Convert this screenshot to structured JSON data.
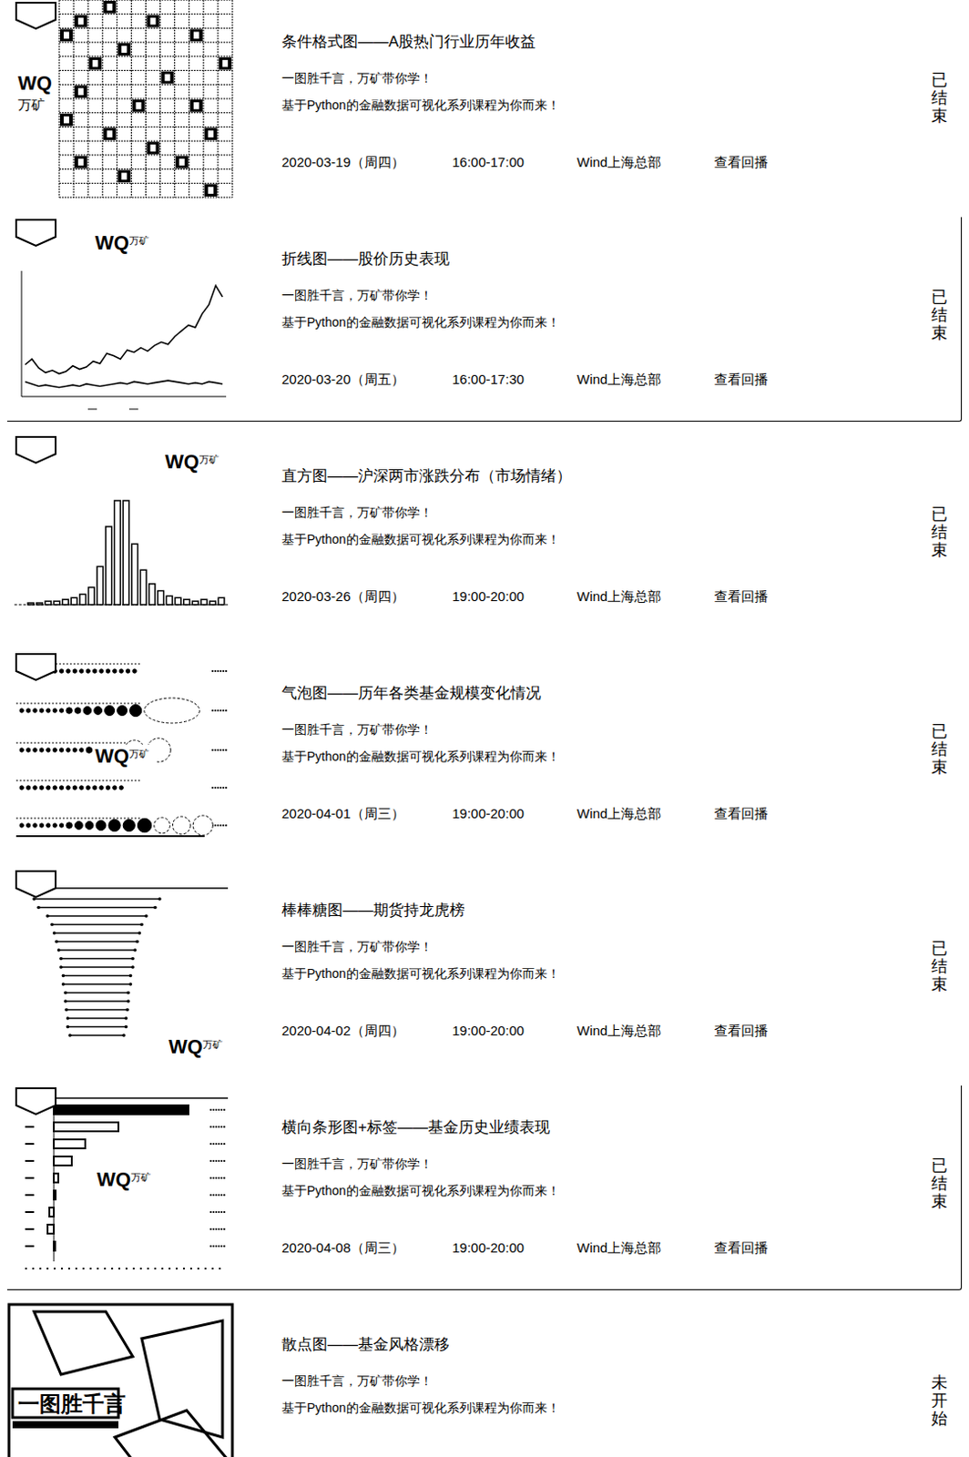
{
  "logo": {
    "mark": "WQ",
    "name": "万矿"
  },
  "courses": [
    {
      "title": "条件格式图——A股热门行业历年收益",
      "desc": [
        "一图胜千言，万矿带你学！",
        "基于Python的金融数据可视化系列课程为你而来！"
      ],
      "meta": {
        "date": "2020-03-19（周四）",
        "time": "16:00-17:00",
        "place": "Wind上海总部",
        "action": "查看回播"
      },
      "status": "已结束",
      "hovered": false,
      "thumb": {
        "kind": "grid",
        "rows": 14,
        "cols": 12,
        "marked": [
          [
            0,
            3
          ],
          [
            1,
            1
          ],
          [
            1,
            6
          ],
          [
            2,
            0
          ],
          [
            2,
            9
          ],
          [
            3,
            4
          ],
          [
            4,
            2
          ],
          [
            4,
            11
          ],
          [
            5,
            7
          ],
          [
            6,
            1
          ],
          [
            7,
            5
          ],
          [
            7,
            9
          ],
          [
            8,
            0
          ],
          [
            9,
            3
          ],
          [
            9,
            10
          ],
          [
            10,
            6
          ],
          [
            11,
            1
          ],
          [
            11,
            8
          ],
          [
            12,
            4
          ],
          [
            13,
            10
          ]
        ]
      }
    },
    {
      "title": "折线图——股价历史表现",
      "desc": [
        "一图胜千言，万矿带你学！",
        "基于Python的金融数据可视化系列课程为你而来！"
      ],
      "meta": {
        "date": "2020-03-20（周五）",
        "time": "16:00-17:30",
        "place": "Wind上海总部",
        "action": "查看回播"
      },
      "status": "已结束",
      "hovered": true,
      "thumb": {
        "kind": "line",
        "series": [
          [
            25,
            30,
            22,
            18,
            20,
            17,
            19,
            24,
            21,
            23,
            28,
            26,
            35,
            33,
            30,
            38,
            36,
            40,
            37,
            42,
            45,
            43,
            50,
            55,
            60,
            58,
            70,
            78,
            95,
            85
          ],
          [
            10,
            8,
            6,
            7,
            6,
            5,
            6,
            7,
            6,
            8,
            7,
            6,
            7,
            8,
            9,
            8,
            10,
            9,
            8,
            9,
            10,
            11,
            10,
            9,
            8,
            9,
            8,
            10,
            9,
            8
          ]
        ]
      }
    },
    {
      "title": "直方图——沪深两市涨跌分布（市场情绪）",
      "desc": [
        "一图胜千言，万矿带你学！",
        "基于Python的金融数据可视化系列课程为你而来！"
      ],
      "meta": {
        "date": "2020-03-26（周四）",
        "time": "19:00-20:00",
        "place": "Wind上海总部",
        "action": "查看回播"
      },
      "status": "已结束",
      "hovered": false,
      "thumb": {
        "kind": "histogram",
        "values": [
          1,
          1,
          2,
          2,
          3,
          4,
          6,
          10,
          22,
          45,
          60,
          60,
          35,
          20,
          12,
          8,
          5,
          4,
          3,
          2,
          3,
          2,
          4
        ]
      }
    },
    {
      "title": "气泡图——历年各类基金规模变化情况",
      "desc": [
        "一图胜千言，万矿带你学！",
        "基于Python的金融数据可视化系列课程为你而来！"
      ],
      "meta": {
        "date": "2020-04-01（周三）",
        "time": "19:00-20:00",
        "place": "Wind上海总部",
        "action": "查看回播"
      },
      "status": "已结束",
      "hovered": false,
      "thumb": {
        "kind": "bubble",
        "rows": [
          [
            1,
            1,
            1,
            1,
            1,
            1,
            1,
            1,
            1,
            1,
            1,
            1,
            1,
            1,
            1,
            1,
            1,
            1
          ],
          [
            1,
            1,
            1,
            1,
            1,
            1,
            1,
            1.5,
            1.5,
            2,
            2,
            2.5,
            2.5,
            3,
            14
          ],
          [
            1,
            1,
            1,
            1,
            1,
            1,
            1,
            1,
            1,
            1,
            1.5,
            1.5,
            2,
            2,
            5,
            6
          ],
          [
            1,
            1,
            1,
            1,
            1,
            1,
            1,
            1,
            1,
            1,
            1,
            1,
            1,
            1,
            1,
            1
          ],
          [
            1,
            1,
            1,
            1,
            1,
            1,
            1,
            1.5,
            2,
            2,
            2.5,
            3,
            3,
            3.5,
            4,
            4.5,
            5
          ]
        ]
      }
    },
    {
      "title": "棒棒糖图——期货持龙虎榜",
      "desc": [
        "一图胜千言，万矿带你学！",
        "基于Python的金融数据可视化系列课程为你而来！"
      ],
      "meta": {
        "date": "2020-04-02（周四）",
        "time": "19:00-20:00",
        "place": "Wind上海总部",
        "action": "查看回播"
      },
      "status": "已结束",
      "hovered": false,
      "thumb": {
        "kind": "lollipop",
        "values": [
          160,
          150,
          130,
          120,
          115,
          110,
          105,
          100,
          100,
          95,
          95,
          90,
          90,
          88,
          85,
          85,
          80
        ]
      }
    },
    {
      "title": "横向条形图+标签——基金历史业绩表现",
      "desc": [
        "一图胜千言，万矿带你学！",
        "基于Python的金融数据可视化系列课程为你而来！"
      ],
      "meta": {
        "date": "2020-04-08（周三）",
        "time": "19:00-20:00",
        "place": "Wind上海总部",
        "action": "查看回播"
      },
      "status": "已结束",
      "hovered": true,
      "thumb": {
        "kind": "hbar",
        "values": [
          150,
          72,
          35,
          20,
          5,
          2,
          -5,
          -7,
          1
        ]
      }
    },
    {
      "title": "散点图——基金风格漂移",
      "desc": [
        "一图胜千言，万矿带你学！",
        "基于Python的金融数据可视化系列课程为你而来！"
      ],
      "status": "未开始",
      "hovered": false,
      "thumb": {
        "kind": "illustration",
        "caption": "一图胜千言"
      }
    }
  ]
}
